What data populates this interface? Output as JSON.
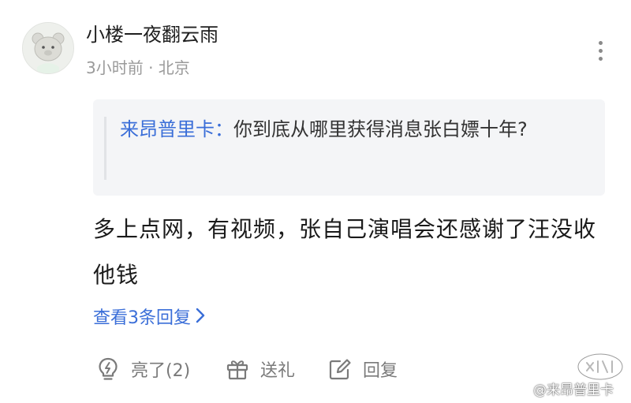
{
  "comment": {
    "username": "小楼一夜翻云雨",
    "meta": "3小时前 · 北京",
    "quote": {
      "author": "来昂普里卡：",
      "text": "你到底从哪里获得消息张白嫖十年?"
    },
    "body": "多上点网，有视频，张自己演唱会还感谢了汪没收他钱",
    "view_replies": "查看3条回复"
  },
  "actions": {
    "like_label": "亮了(2)",
    "gift_label": "送礼",
    "reply_label": "回复"
  },
  "watermark": {
    "text": "@来昂普里卡"
  },
  "icons": {
    "avatar": "bear-avatar",
    "more": "more-vertical-icon",
    "like": "lightbulb-icon",
    "gift": "gift-icon",
    "reply": "edit-icon",
    "chevron": "chevron-right-icon"
  },
  "colors": {
    "link": "#3a6ed8",
    "text_primary": "#1a1a1a",
    "text_secondary": "#9a9a9a",
    "quote_bg": "#f4f5f7"
  }
}
